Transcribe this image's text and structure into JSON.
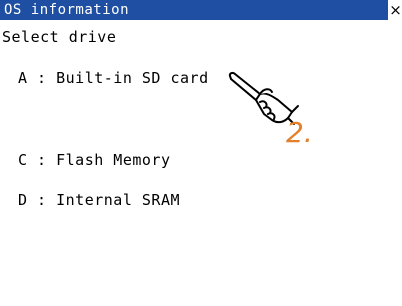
{
  "window": {
    "title": "OS information",
    "close_glyph": "×"
  },
  "prompt": "Select drive",
  "drives": [
    {
      "label": "A : Built-in SD card"
    },
    {
      "label": "C : Flash Memory"
    },
    {
      "label": "D : Internal SRAM"
    }
  ],
  "annotation": {
    "step_label": "2.",
    "icon": "pointing-hand-icon",
    "color": "#e3802b"
  },
  "colors": {
    "titlebar": "#1f4fa3",
    "background": "#ffffff"
  }
}
